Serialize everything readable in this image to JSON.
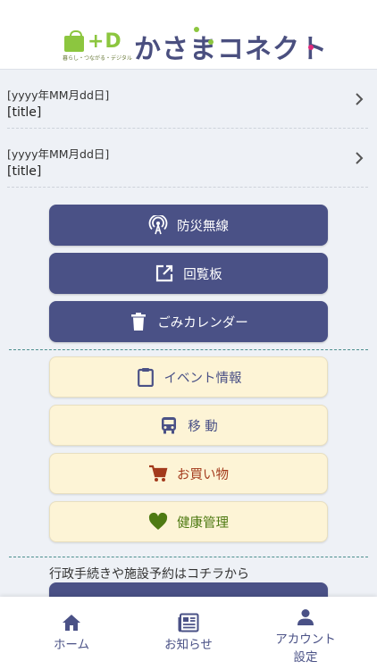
{
  "header": {
    "logo_mark": "+D",
    "logo_sub": "暮らし・つながる・デジタル",
    "logo_text": "かさまコネクト"
  },
  "notices": [
    {
      "date": "[yyyy年MM月dd日]",
      "title": "[title]"
    },
    {
      "date": "[yyyy年MM月dd日]",
      "title": "[title]"
    }
  ],
  "primary_buttons": [
    {
      "label": "防災無線",
      "icon": "radio-tower-icon"
    },
    {
      "label": "回覧板",
      "icon": "external-link-icon"
    },
    {
      "label": "ごみカレンダー",
      "icon": "trash-icon"
    }
  ],
  "secondary_buttons": [
    {
      "label": "イベント情報",
      "icon": "clipboard-icon",
      "color": "#4a5186"
    },
    {
      "label": "移 動",
      "icon": "bus-icon",
      "color": "#4a5186"
    },
    {
      "label": "お買い物",
      "icon": "cart-icon",
      "color": "#a33a1c"
    },
    {
      "label": "健康管理",
      "icon": "heart-icon",
      "color": "#4e7a12"
    }
  ],
  "procedure_text": "行政手続きや施設予約はコチラから",
  "bottom_nav": [
    {
      "label": "ホーム",
      "icon": "home-icon"
    },
    {
      "label": "お知らせ",
      "icon": "news-icon"
    },
    {
      "label": "アカウント\n設定",
      "icon": "account-icon"
    }
  ],
  "colors": {
    "primary": "#4a5186",
    "secondary_bg": "#fdf4d6",
    "brand_green": "#8cc63f",
    "divider": "#4c8f8e"
  }
}
